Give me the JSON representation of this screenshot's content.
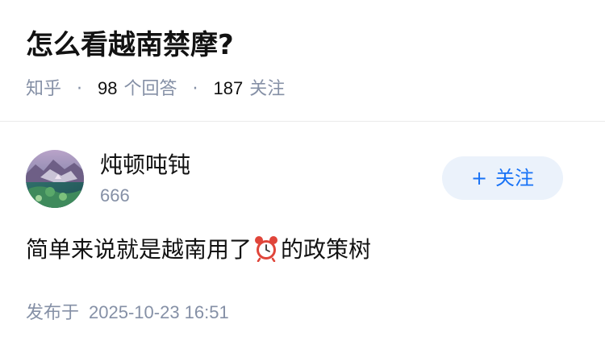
{
  "question": {
    "title": "怎么看越南禁摩?",
    "source": "知乎",
    "answer_count": "98",
    "answer_label": "个回答",
    "follower_count": "187",
    "follower_label": "关注",
    "separator": "·"
  },
  "author": {
    "name": "炖顿吨钝",
    "bio": "666",
    "avatar_icon": "avatar-landscape-image"
  },
  "follow_button": {
    "plus": "+",
    "label": "关注"
  },
  "answer": {
    "text_before": "简单来说就是越南用了",
    "emoji_icon": "alarm-clock-icon",
    "text_after": "的政策树"
  },
  "publish": {
    "label": "发布于",
    "datetime": "2025-10-23 16:51"
  },
  "colors": {
    "title": "#121212",
    "meta_gray": "#8590a6",
    "accent_blue": "#1772f6",
    "follow_bg": "#ebf2fb",
    "divider": "#ebebeb"
  }
}
